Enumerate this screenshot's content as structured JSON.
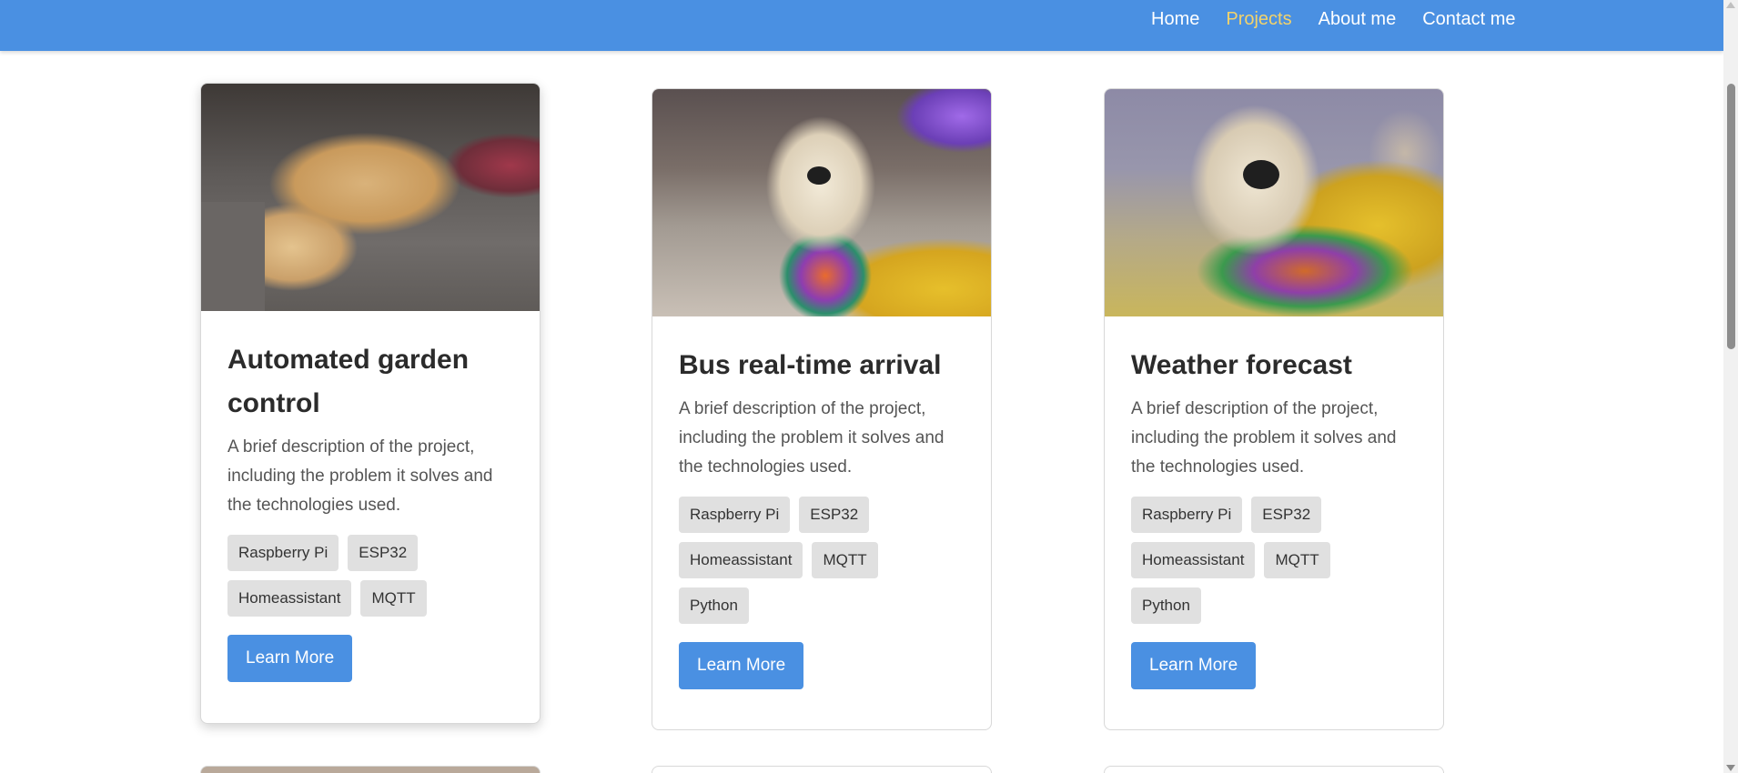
{
  "nav": {
    "links": [
      {
        "label": "Home",
        "active": false
      },
      {
        "label": "Projects",
        "active": true
      },
      {
        "label": "About me",
        "active": false
      },
      {
        "label": "Contact me",
        "active": false
      }
    ],
    "accent_color": "#4a90e2",
    "active_color": "#f3d36b"
  },
  "projects": [
    {
      "title": "Automated garden control",
      "description": "A brief description of the project, including the problem it solves and the technologies used.",
      "tags": [
        "Raspberry Pi",
        "ESP32",
        "Homeassistant",
        "MQTT"
      ],
      "button": "Learn More"
    },
    {
      "title": "Bus real-time arrival",
      "description": "A brief description of the project, including the problem it solves and the technologies used.",
      "tags": [
        "Raspberry Pi",
        "ESP32",
        "Homeassistant",
        "MQTT",
        "Python"
      ],
      "button": "Learn More"
    },
    {
      "title": "Weather forecast",
      "description": "A brief description of the project, including the problem it solves and the technologies used.",
      "tags": [
        "Raspberry Pi",
        "ESP32",
        "Homeassistant",
        "MQTT",
        "Python"
      ],
      "button": "Learn More"
    }
  ],
  "icons": {
    "scroll_down": "chevron-down-icon",
    "scroll_up": "chevron-up-icon"
  }
}
